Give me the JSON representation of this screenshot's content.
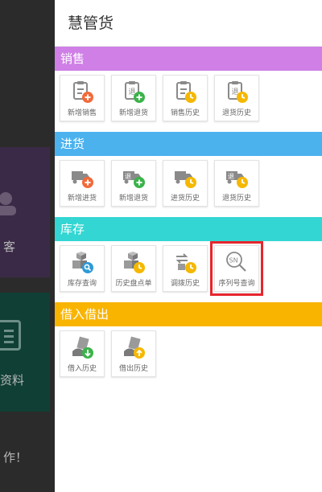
{
  "background": {
    "left_text_1": "客",
    "left_text_2": "资料",
    "left_text_3": "作！"
  },
  "drawer": {
    "title": "慧管货",
    "sections": [
      {
        "header": "销售",
        "color": "#cf7fe6",
        "items": [
          {
            "label": "新增销售",
            "icon": "clipboard-plus-icon"
          },
          {
            "label": "新增退货",
            "icon": "clipboard-return-plus-icon"
          },
          {
            "label": "销售历史",
            "icon": "clipboard-clock-icon"
          },
          {
            "label": "退货历史",
            "icon": "clipboard-return-clock-icon"
          }
        ]
      },
      {
        "header": "进货",
        "color": "#4cb2ee",
        "items": [
          {
            "label": "新增进货",
            "icon": "truck-plus-icon"
          },
          {
            "label": "新增退货",
            "icon": "truck-return-plus-icon"
          },
          {
            "label": "进货历史",
            "icon": "truck-clock-icon"
          },
          {
            "label": "退货历史",
            "icon": "truck-return-clock-icon"
          }
        ]
      },
      {
        "header": "库存",
        "color": "#33d6d2",
        "items": [
          {
            "label": "库存查询",
            "icon": "boxes-search-icon"
          },
          {
            "label": "历史盘点单",
            "icon": "boxes-clock-icon"
          },
          {
            "label": "调拨历史",
            "icon": "transfer-clock-icon"
          },
          {
            "label": "序列号查询",
            "icon": "sn-search-icon"
          }
        ]
      },
      {
        "header": "借入借出",
        "color": "#f9b400",
        "items": [
          {
            "label": "借入历史",
            "icon": "borrow-in-icon"
          },
          {
            "label": "借出历史",
            "icon": "borrow-out-icon"
          }
        ]
      }
    ]
  }
}
